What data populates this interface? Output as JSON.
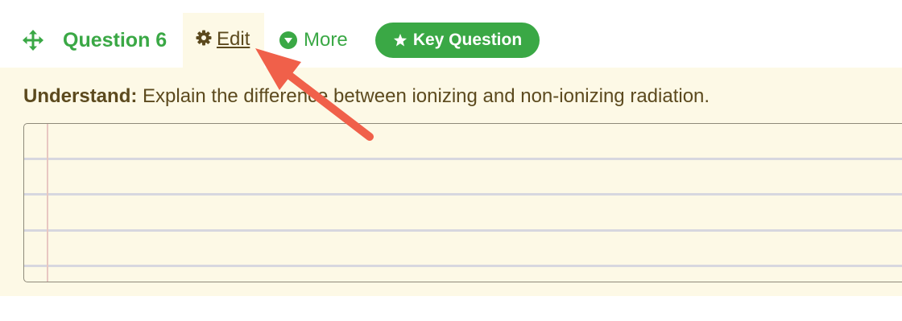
{
  "toolbar": {
    "move_icon": "move-arrows-icon",
    "question_title": "Question 6",
    "edit": {
      "icon": "gear-icon",
      "label": "Edit"
    },
    "more": {
      "icon": "chevron-down-circle-icon",
      "label": "More"
    },
    "key_question": {
      "icon": "star-icon",
      "label": "Key Question"
    }
  },
  "question": {
    "level_label": "Understand:",
    "prompt_text": " Explain the difference between ionizing and non-ionizing radiation."
  },
  "answer_area": {
    "value": "",
    "style": "lined-notepad"
  },
  "annotation": {
    "type": "arrow",
    "points_to": "edit-button",
    "color": "#f0604a"
  },
  "colors": {
    "green_accent": "#3aa845",
    "brown_text": "#5c4a1e",
    "panel_background": "#fdf9e6",
    "annotation_arrow": "#f0604a"
  }
}
